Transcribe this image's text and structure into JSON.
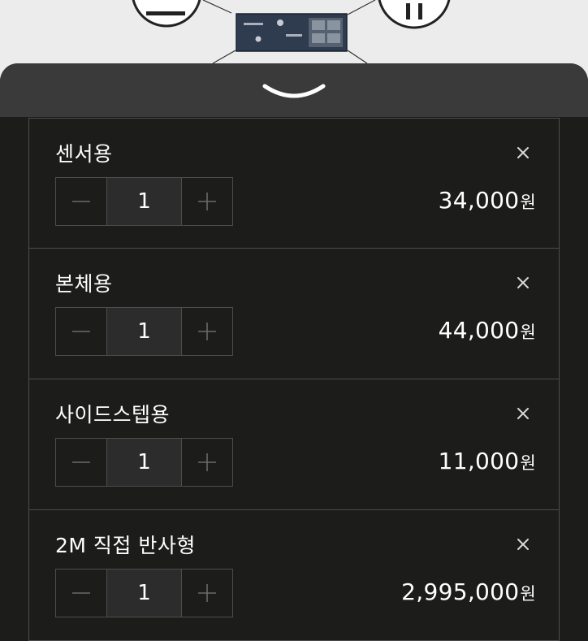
{
  "colors": {
    "background": "#1c1d1b",
    "handle": "#3a3a3a",
    "border": "#4d4e4c",
    "qty_bg": "#2c2c2c",
    "text": "#ffffff",
    "icon_muted": "#6a6a6a"
  },
  "drawer": {
    "toggle_icon": "chevron-down-icon"
  },
  "items": [
    {
      "name": "센서용",
      "quantity": "1",
      "price": "34,000",
      "currency": "원"
    },
    {
      "name": "본체용",
      "quantity": "1",
      "price": "44,000",
      "currency": "원"
    },
    {
      "name": "사이드스텝용",
      "quantity": "1",
      "price": "11,000",
      "currency": "원"
    },
    {
      "name": "2M 직접 반사형",
      "quantity": "1",
      "price": "2,995,000",
      "currency": "원"
    }
  ]
}
